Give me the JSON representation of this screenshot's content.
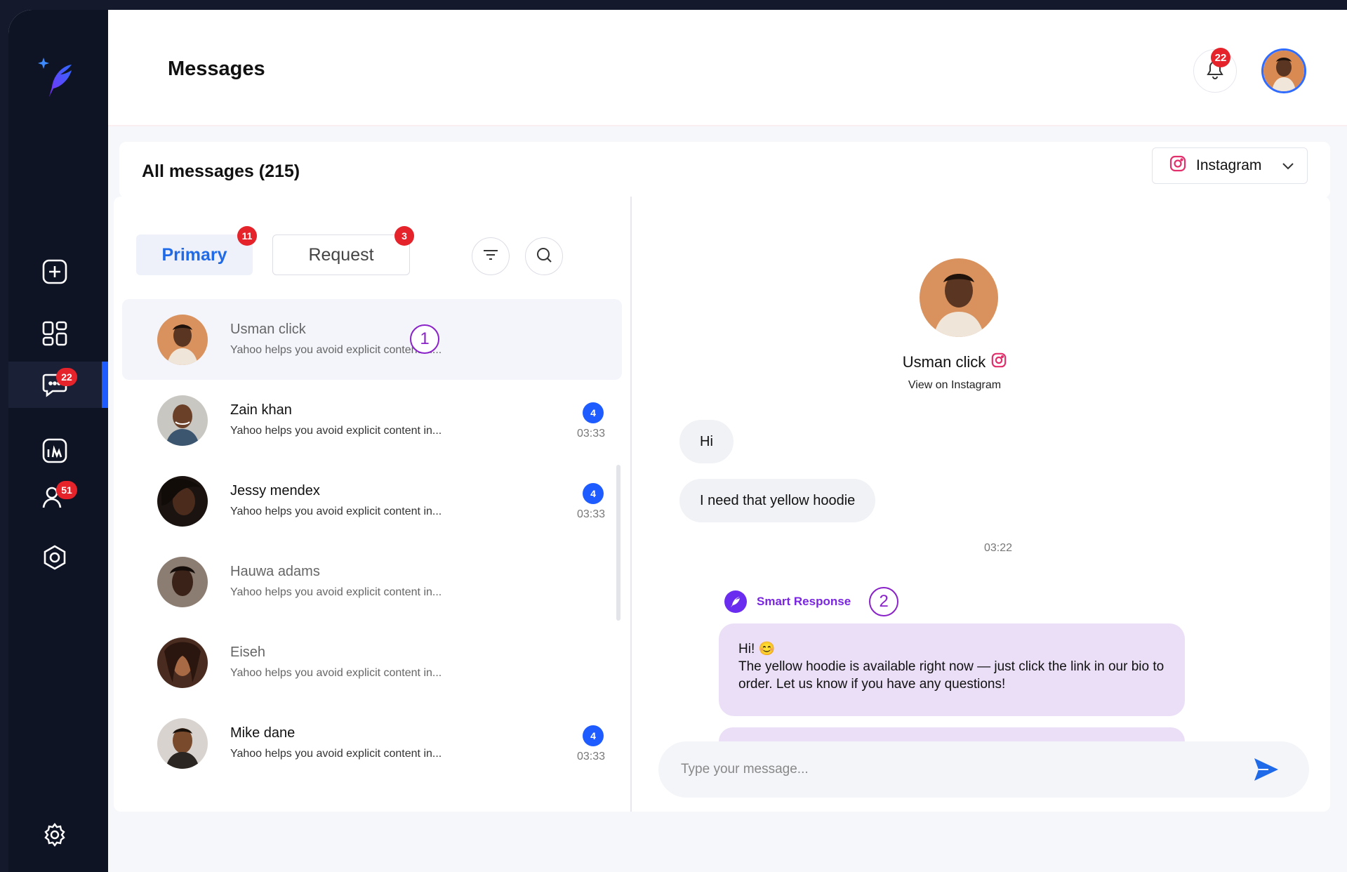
{
  "page": {
    "title": "Messages"
  },
  "sidebar": {
    "badges": {
      "messages": "22",
      "contacts": "51"
    }
  },
  "topbar": {
    "notifications_count": "22"
  },
  "inbox": {
    "heading": "All messages (215)",
    "platform": {
      "label": "Instagram"
    },
    "tabs": [
      {
        "label": "Primary",
        "badge": "11"
      },
      {
        "label": "Request",
        "badge": "3"
      }
    ],
    "conversations": [
      {
        "name": "Usman click",
        "preview": "Yahoo helps you avoid explicit content in...",
        "count": "",
        "time": ""
      },
      {
        "name": "Zain khan",
        "preview": "Yahoo helps you avoid explicit content in...",
        "count": "4",
        "time": "03:33"
      },
      {
        "name": "Jessy mendex",
        "preview": "Yahoo helps you avoid explicit content in...",
        "count": "4",
        "time": "03:33"
      },
      {
        "name": "Hauwa adams",
        "preview": "Yahoo helps you avoid explicit content in...",
        "count": "",
        "time": ""
      },
      {
        "name": "Eiseh",
        "preview": "Yahoo helps you avoid explicit content in...",
        "count": "",
        "time": ""
      },
      {
        "name": "Mike dane",
        "preview": "Yahoo helps you avoid explicit content in...",
        "count": "4",
        "time": "03:33"
      }
    ]
  },
  "annotations": {
    "marker_1": "1",
    "marker_2": "2"
  },
  "chat": {
    "contact_name": "Usman click",
    "profile_link": "View on Instagram",
    "messages": [
      {
        "text": "Hi"
      },
      {
        "text": "I need that yellow hoodie"
      }
    ],
    "time": "03:22",
    "smart_response": {
      "label": "Smart Response",
      "greeting": "Hi! 😊",
      "text": "The yellow hoodie is available right now — just click the link in our bio to order. Let us know if you have any questions!"
    },
    "composer_placeholder": "Type your message..."
  },
  "colors": {
    "accent": "#1f5cff",
    "badge": "#e5232b",
    "smart": "#7a26e0",
    "sidebar": "#0f1425"
  }
}
